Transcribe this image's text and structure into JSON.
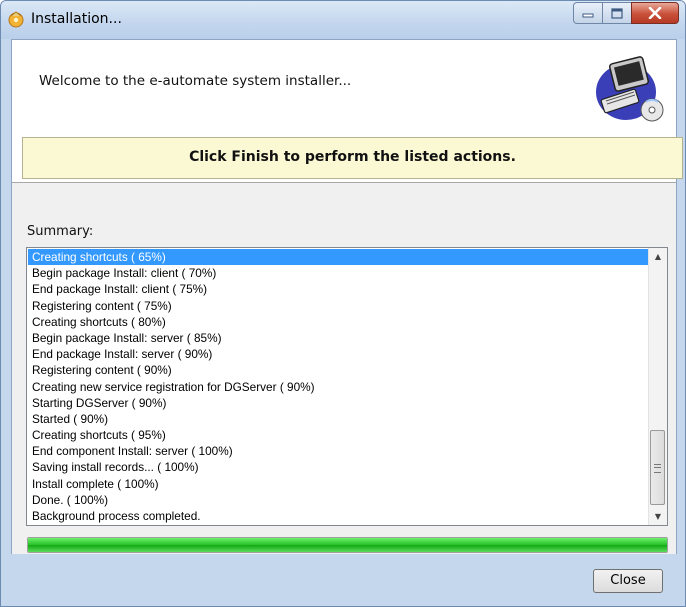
{
  "window": {
    "title": "Installation...",
    "buttons": {
      "minimize": "minimize",
      "maximize": "maximize",
      "close": "close"
    }
  },
  "header": {
    "welcome_text": "Welcome to the e-automate system installer...",
    "icon": "computer-with-cd-icon"
  },
  "banner": {
    "text": "Click Finish to perform the listed actions."
  },
  "summary": {
    "label": "Summary:",
    "selected_index": 0,
    "items": [
      "Creating shortcuts ( 65%)",
      "Begin package Install: client ( 70%)",
      "End package Install: client ( 75%)",
      "Registering content ( 75%)",
      "Creating shortcuts ( 80%)",
      "Begin package Install: server ( 85%)",
      "End package Install: server ( 90%)",
      "Registering content ( 90%)",
      "Creating new service registration for DGServer ( 90%)",
      "Starting DGServer ( 90%)",
      "Started ( 90%)",
      "Creating shortcuts ( 95%)",
      "End component Install: server ( 100%)",
      "Saving install records... ( 100%)",
      "Install complete ( 100%)",
      "Done. ( 100%)",
      "Background process completed."
    ]
  },
  "progress": {
    "percent": 100,
    "color": "#27c027"
  },
  "footer": {
    "close_label": "Close"
  },
  "colors": {
    "frame": "#c5d7ec",
    "banner_bg": "#fbf8d4",
    "selection": "#3399ff",
    "close_button_red": "#c9503a"
  }
}
